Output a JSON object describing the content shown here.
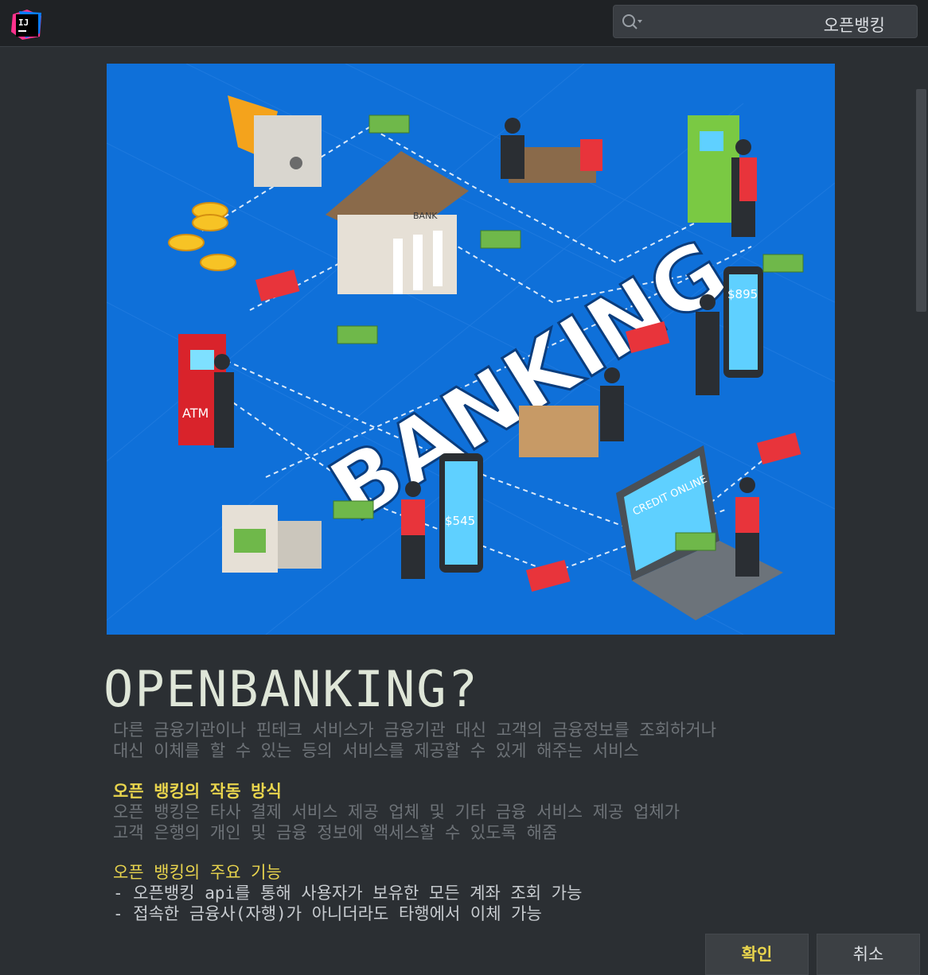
{
  "app": {
    "icon": "intellij-logo"
  },
  "search": {
    "icon": "search-icon",
    "value": "오픈뱅킹"
  },
  "hero": {
    "text": "BANKING",
    "atm_label": "ATM",
    "bank_label": "BANK",
    "credit_label": "CREDIT ONLINE",
    "price1": "$895",
    "price2": "$545"
  },
  "content": {
    "title": "OPENBANKING?",
    "intro": [
      "다른 금융기관이나 핀테크 서비스가 금융기관 대신 고객의 금융정보를 조회하거나",
      "대신 이체를 할 수 있는 등의 서비스를 제공할 수 있게 해주는 서비스"
    ],
    "section1_heading": "오픈 뱅킹의 작동 방식",
    "section1_lines": [
      "오픈 뱅킹은 타사 결제 서비스 제공 업체 및 기타 금융 서비스 제공 업체가",
      "고객 은행의 개인 및 금융 정보에 액세스할 수 있도록 해줌"
    ],
    "section2_heading": "오픈 뱅킹의 주요 기능",
    "section2_lines": [
      "- 오픈뱅킹 api를 통해 사용자가 보유한 모든 계좌 조회 가능",
      "- 접속한 금융사(자행)가 아니더라도 타행에서 이체 가능"
    ]
  },
  "buttons": {
    "ok": "확인",
    "cancel": "취소"
  },
  "colors": {
    "background": "#2b2f33",
    "accent": "#e8d44d",
    "hero_bg": "#0f70d9"
  }
}
